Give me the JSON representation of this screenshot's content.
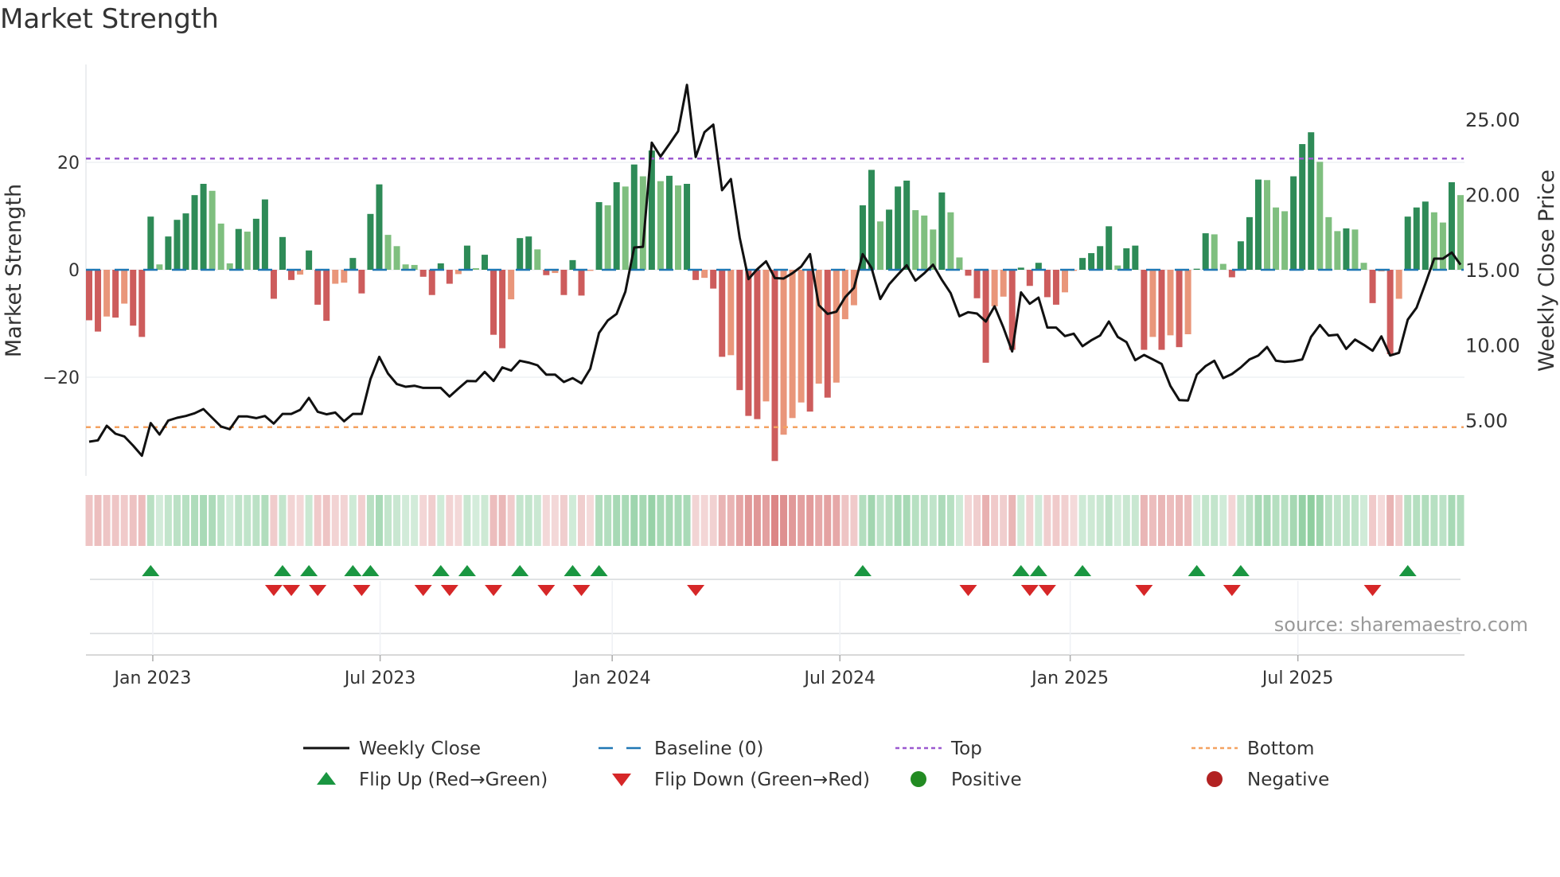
{
  "title": "Market Strength",
  "source": "source: sharemaestro.com",
  "colors": {
    "dark_green": "#2e8b57",
    "light_green": "#7fbf7f",
    "dark_red": "#cd5c5c",
    "light_red": "#e9967a",
    "price": "#111111",
    "baseline": "#1f77b4",
    "top": "#9b59d0",
    "bottom": "#f4a261",
    "flip_up": "#1a9641",
    "flip_down": "#d62728",
    "positive": "#228b22",
    "negative": "#b22222"
  },
  "chart_data": {
    "type": "bar+line",
    "title": "Market Strength",
    "ylabel": "Market Strength",
    "y2label": "Weekly Close Price",
    "ylim": [
      -38,
      40
    ],
    "y2lim": [
      1.2,
      29.3
    ],
    "yticks": [
      {
        "v": 20,
        "label": "20"
      },
      {
        "v": 0,
        "label": "0"
      },
      {
        "v": -20,
        "label": "−20"
      }
    ],
    "y2ticks": [
      {
        "v": 25,
        "label": "25.00"
      },
      {
        "v": 20,
        "label": "20.00"
      },
      {
        "v": 15,
        "label": "15.00"
      },
      {
        "v": 10,
        "label": "10.00"
      },
      {
        "v": 5,
        "label": "5.00"
      }
    ],
    "xticks": [
      {
        "x": 7.24,
        "label": "Jan 2023"
      },
      {
        "x": 33.1,
        "label": "Jul 2023"
      },
      {
        "x": 59.5,
        "label": "Jan 2024"
      },
      {
        "x": 85.4,
        "label": "Jul 2024"
      },
      {
        "x": 111.6,
        "label": "Jan 2025"
      },
      {
        "x": 137.5,
        "label": "Jul 2025"
      }
    ],
    "top_level": 20.7,
    "bottom_level": -29.3,
    "baseline": 0,
    "strength": [
      -9.4,
      -11.5,
      -8.7,
      -8.9,
      -6.3,
      -10.4,
      -12.5,
      9.9,
      1.0,
      6.2,
      9.3,
      10.5,
      13.9,
      16.0,
      14.7,
      8.6,
      1.2,
      7.6,
      7.1,
      9.5,
      13.1,
      -5.4,
      6.1,
      -1.9,
      -0.9,
      3.6,
      -6.5,
      -9.5,
      -2.6,
      -2.4,
      2.2,
      -4.4,
      10.4,
      15.9,
      6.5,
      4.4,
      1.0,
      0.9,
      -1.3,
      -4.7,
      1.2,
      -2.6,
      -0.8,
      4.5,
      0.3,
      2.8,
      -12.1,
      -14.6,
      -5.5,
      5.9,
      6.2,
      3.8,
      -1.0,
      -0.6,
      -4.7,
      1.8,
      -4.8,
      -0.2,
      12.6,
      12.0,
      16.3,
      15.5,
      19.6,
      17.4,
      22.2,
      16.5,
      17.5,
      15.7,
      16.0,
      -1.9,
      -1.5,
      -3.5,
      -16.2,
      -15.9,
      -22.4,
      -27.2,
      -27.8,
      -24.5,
      -35.6,
      -30.7,
      -27.6,
      -24.7,
      -26.4,
      -21.2,
      -23.8,
      -21.0,
      -9.2,
      -6.6,
      12.0,
      18.6,
      9.0,
      11.2,
      15.5,
      16.6,
      11.1,
      10.1,
      7.5,
      14.4,
      10.7,
      2.3,
      -1.1,
      -5.3,
      -17.3,
      -6.8,
      -5.0,
      -14.9,
      0.4,
      -3.0,
      1.3,
      -5.1,
      -6.5,
      -4.2,
      -0.2,
      2.2,
      3.1,
      4.4,
      8.1,
      0.8,
      4.0,
      4.5,
      -14.9,
      -12.5,
      -14.9,
      -12.2,
      -14.4,
      -12.0,
      0.2,
      6.8,
      6.6,
      1.1,
      -1.4,
      5.3,
      9.8,
      16.8,
      16.7,
      11.6,
      10.9,
      17.4,
      23.4,
      25.6,
      20.1,
      9.8,
      7.2,
      7.7,
      7.5,
      1.3,
      -6.2,
      -0.3,
      -15.7,
      -5.4,
      9.9,
      11.6,
      12.7,
      10.7,
      8.8,
      16.3,
      13.9
    ],
    "weekly_close": [
      3.57,
      3.66,
      4.63,
      4.1,
      3.92,
      3.31,
      2.64,
      4.81,
      4.05,
      4.98,
      5.16,
      5.28,
      5.46,
      5.74,
      5.16,
      4.58,
      4.4,
      5.25,
      5.25,
      5.14,
      5.28,
      4.77,
      5.42,
      5.42,
      5.69,
      6.48,
      5.56,
      5.39,
      5.51,
      4.93,
      5.42,
      5.42,
      7.72,
      9.21,
      8.1,
      7.4,
      7.22,
      7.29,
      7.15,
      7.15,
      7.15,
      6.57,
      7.1,
      7.61,
      7.59,
      8.21,
      7.61,
      8.51,
      8.3,
      8.95,
      8.83,
      8.65,
      8.03,
      8.03,
      7.54,
      7.8,
      7.45,
      8.42,
      10.8,
      11.63,
      12.07,
      13.54,
      16.48,
      16.53,
      23.45,
      22.53,
      23.36,
      24.21,
      27.29,
      22.5,
      24.15,
      24.65,
      20.29,
      21.03,
      17.15,
      14.38,
      15.04,
      15.56,
      14.45,
      14.42,
      14.77,
      15.21,
      16.04,
      12.65,
      12.07,
      12.21,
      13.18,
      13.8,
      16.04,
      15.12,
      13.06,
      14.03,
      14.68,
      15.3,
      14.28,
      14.77,
      15.34,
      14.33,
      13.45,
      11.91,
      12.18,
      12.09,
      11.56,
      12.57,
      11.16,
      9.57,
      13.5,
      12.74,
      13.15,
      11.16,
      11.16,
      10.59,
      10.75,
      9.92,
      10.31,
      10.63,
      11.56,
      10.54,
      10.19,
      8.99,
      9.34,
      9.04,
      8.74,
      7.28,
      6.34,
      6.31,
      8.03,
      8.6,
      8.95,
      7.8,
      8.07,
      8.51,
      9.04,
      9.3,
      9.87,
      8.95,
      8.88,
      8.92,
      9.04,
      10.54,
      11.33,
      10.63,
      10.68,
      9.74,
      10.36,
      10.01,
      9.62,
      10.57,
      9.3,
      9.48,
      11.68,
      12.48,
      14.07,
      15.74,
      15.74,
      16.15,
      15.34
    ],
    "legend": [
      {
        "key": "close",
        "label": "Weekly Close"
      },
      {
        "key": "baseline",
        "label": "Baseline (0)"
      },
      {
        "key": "top",
        "label": "Top"
      },
      {
        "key": "bottom",
        "label": "Bottom"
      },
      {
        "key": "flip_up",
        "label": "Flip Up (Red→Green)"
      },
      {
        "key": "flip_down",
        "label": "Flip Down (Green→Red)"
      },
      {
        "key": "positive",
        "label": "Positive"
      },
      {
        "key": "negative",
        "label": "Negative"
      }
    ],
    "legend_position": "bottom"
  }
}
